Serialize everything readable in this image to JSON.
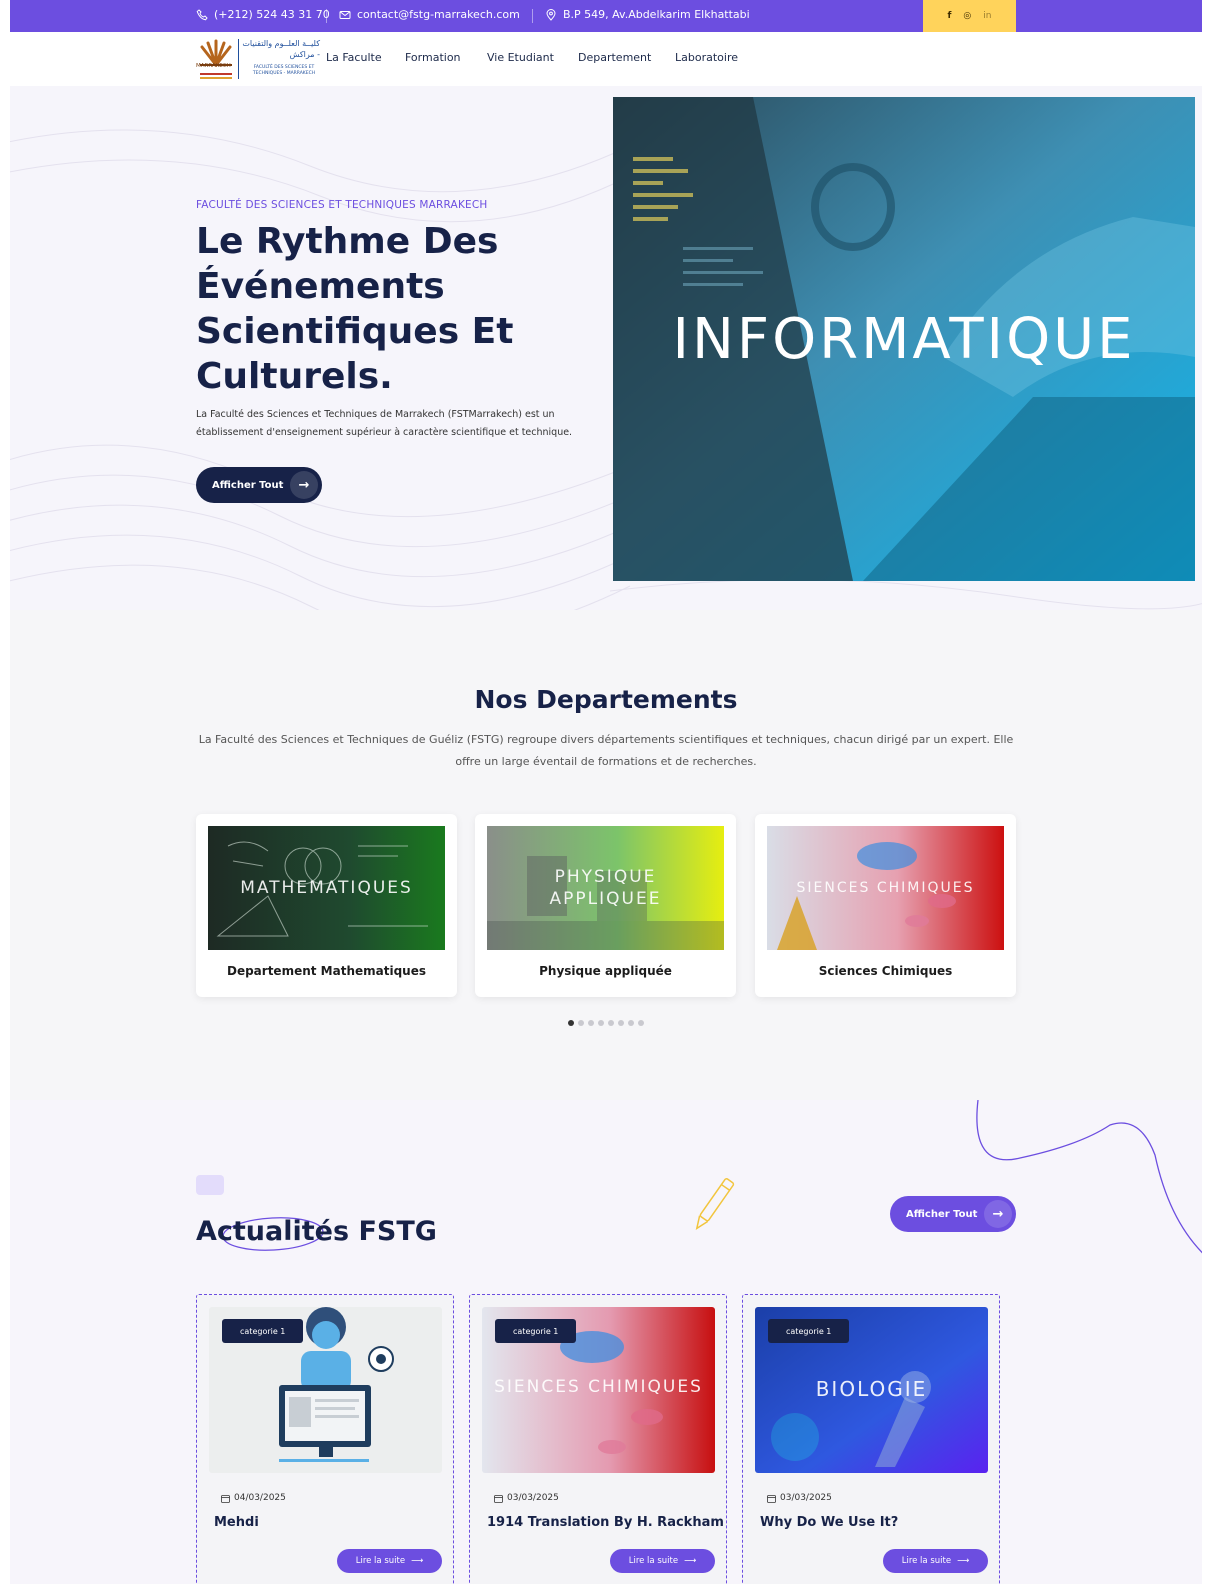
{
  "topbar": {
    "phone": "(+212) 524 43 31 70",
    "email": "contact@fstg-marrakech.com",
    "address": "B.P 549, Av.Abdelkarim Elkhattabi",
    "social": [
      "f",
      "◎",
      "in"
    ]
  },
  "nav": {
    "logo_arabic": "كليــة العلــوم والتقنيات - مراكش",
    "logo_french": "FACULTÉ DES SCIENCES ET TECHNIQUES - MARRAKECH",
    "logo_left": "MARRAKECH",
    "links": [
      "La Faculte",
      "Formation",
      "Vie Etudiant",
      "Departement",
      "Laboratoire"
    ]
  },
  "hero": {
    "kicker": "FACULTÉ DES SCIENCES ET TECHNIQUES MARRAKECH",
    "title": "Le Rythme Des Événements Scientifiques Et Culturels.",
    "description": "La Faculté des Sciences et Techniques de Marrakech (FSTMarrakech) est un établissement d'enseignement supérieur à caractère scientifique et technique.",
    "button": "Afficher Tout",
    "image_label": "INFORMATIQUE"
  },
  "departments": {
    "title": "Nos Departements",
    "description": "La Faculté des Sciences et Techniques de Guéliz (FSTG) regroupe divers départements scientifiques et techniques, chacun dirigé par un expert. Elle offre un large éventail de formations et de recherches.",
    "cards": [
      {
        "image_label": "MATHEMATIQUES",
        "name": "Departement Mathematiques"
      },
      {
        "image_label": "PHYSIQUE APPLIQUEE",
        "name": "Physique appliquée"
      },
      {
        "image_label": "SIENCES CHIMIQUES",
        "name": "Sciences Chimiques"
      }
    ],
    "carousel": {
      "pages": 8,
      "active": 1
    }
  },
  "news": {
    "title": "Actualités FSTG",
    "button": "Afficher Tout",
    "cards": [
      {
        "category": "categorie 1",
        "image_label": "",
        "date": "04/03/2025",
        "title": "Mehdi",
        "link": "Lire la suite"
      },
      {
        "category": "categorie 1",
        "image_label": "SIENCES CHIMIQUES",
        "date": "03/03/2025",
        "title": "1914 Translation By H. Rackham",
        "link": "Lire la suite"
      },
      {
        "category": "categorie 1",
        "image_label": "BIOLOGIE",
        "date": "03/03/2025",
        "title": "Why Do We Use It?",
        "link": "Lire la suite"
      }
    ]
  },
  "colors": {
    "accent": "#6c4ee0",
    "navy": "#172248",
    "yellow": "#ffd35b"
  }
}
